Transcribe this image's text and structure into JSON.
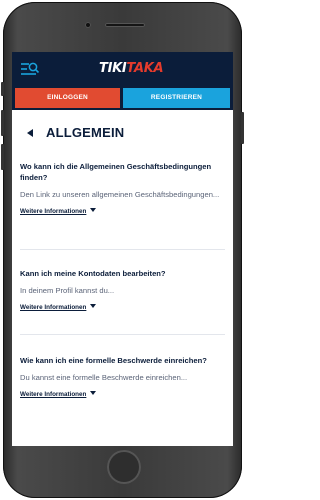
{
  "header": {
    "logo_part1": "TIKI",
    "logo_part2": "TAKA",
    "brand_red": "#e53b2c",
    "header_bg": "#0b1d3a",
    "menu_icon": "menu-search-icon"
  },
  "auth": {
    "login_label": "EINLOGGEN",
    "register_label": "REGISTRIEREN",
    "login_color": "#e14b31",
    "register_color": "#1aa3dd"
  },
  "section": {
    "back_icon": "back-arrow-icon",
    "title": "ALLGEMEIN"
  },
  "faqs": [
    {
      "question": "Wo kann ich die Allgemeinen Geschäftsbedingungen finden?",
      "answer": "Den Link zu unseren allgemeinen Geschäftsbedingungen...",
      "more_label": "Weitere Informationen"
    },
    {
      "question": "Kann ich meine Kontodaten bearbeiten?",
      "answer": "In deinem Profil kannst du...",
      "more_label": "Weitere Informationen"
    },
    {
      "question": "Wie kann ich eine formelle Beschwerde einreichen?",
      "answer": "Du kannst eine formelle Beschwerde einreichen...",
      "more_label": "Weitere Informationen"
    }
  ]
}
